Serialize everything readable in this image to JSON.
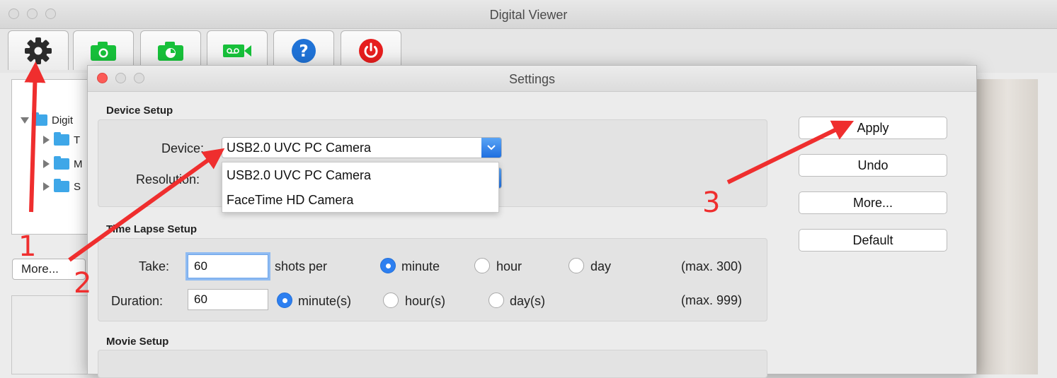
{
  "main_window": {
    "title": "Digital Viewer"
  },
  "toolbar": {
    "items": [
      {
        "icon": "gear-icon"
      },
      {
        "icon": "camera-icon"
      },
      {
        "icon": "timelapse-camera-icon"
      },
      {
        "icon": "video-record-icon"
      },
      {
        "icon": "help-icon"
      },
      {
        "icon": "power-icon"
      }
    ]
  },
  "left_panel": {
    "tree": [
      {
        "label": "Digit",
        "expanded": true
      },
      {
        "label": "T"
      },
      {
        "label": "M"
      },
      {
        "label": "S"
      }
    ],
    "more_label": "More..."
  },
  "settings": {
    "title": "Settings",
    "device_setup": {
      "section_title": "Device Setup",
      "device_label": "Device:",
      "device_value": "USB2.0 UVC PC Camera",
      "resolution_label": "Resolution:",
      "dropdown_options": [
        "USB2.0 UVC PC Camera",
        "FaceTime HD Camera"
      ]
    },
    "time_lapse": {
      "section_title": "Time Lapse Setup",
      "take_label": "Take:",
      "take_value": "60",
      "shots_per_label": "shots per",
      "period_options": [
        "minute",
        "hour",
        "day"
      ],
      "period_selected": "minute",
      "take_max": "(max. 300)",
      "duration_label": "Duration:",
      "duration_value": "60",
      "duration_options": [
        "minute(s)",
        "hour(s)",
        "day(s)"
      ],
      "duration_selected": "minute(s)",
      "duration_max": "(max. 999)"
    },
    "movie_setup": {
      "section_title": "Movie Setup"
    },
    "buttons": {
      "apply": "Apply",
      "undo": "Undo",
      "more": "More...",
      "default": "Default"
    }
  },
  "annotations": {
    "step1": "1",
    "step2": "2",
    "step3": "3"
  },
  "colors": {
    "annotation_red": "#ef2e2e",
    "accent_blue": "#2d7ff0",
    "close_red": "#fc5b57"
  }
}
